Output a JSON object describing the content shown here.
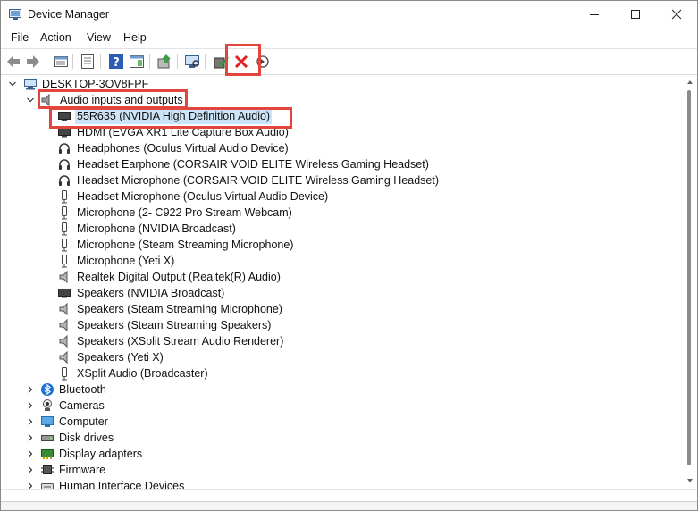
{
  "window": {
    "title": "Device Manager"
  },
  "menu": [
    "File",
    "Action",
    "View",
    "Help"
  ],
  "toolbar": [
    "back-icon",
    "forward-icon",
    "properties-grid-icon",
    "console-tree-icon",
    "help-icon",
    "action-pane-icon",
    "update-driver-icon",
    "scan-hardware-icon",
    "enable-device-icon",
    "uninstall-device-icon",
    "disable-device-icon"
  ],
  "tree": {
    "root": "DESKTOP-3OV8FPF",
    "expanded_category": "Audio inputs and outputs",
    "audio_devices": [
      {
        "label": "55R635 (NVIDIA High Definition Audio)",
        "icon": "monitor-icon"
      },
      {
        "label": "HDMI (EVGA XR1 Lite Capture Box Audio)",
        "icon": "monitor-icon"
      },
      {
        "label": "Headphones (Oculus Virtual Audio Device)",
        "icon": "headphones-icon"
      },
      {
        "label": "Headset Earphone (CORSAIR VOID ELITE Wireless Gaming Headset)",
        "icon": "headphones-icon"
      },
      {
        "label": "Headset Microphone (CORSAIR VOID ELITE Wireless Gaming Headset)",
        "icon": "headphones-icon"
      },
      {
        "label": "Headset Microphone (Oculus Virtual Audio Device)",
        "icon": "microphone-icon"
      },
      {
        "label": "Microphone (2- C922 Pro Stream Webcam)",
        "icon": "microphone-icon"
      },
      {
        "label": "Microphone (NVIDIA Broadcast)",
        "icon": "microphone-icon"
      },
      {
        "label": "Microphone (Steam Streaming Microphone)",
        "icon": "microphone-icon"
      },
      {
        "label": "Microphone (Yeti X)",
        "icon": "microphone-icon"
      },
      {
        "label": "Realtek Digital Output (Realtek(R) Audio)",
        "icon": "speaker-icon"
      },
      {
        "label": "Speakers (NVIDIA Broadcast)",
        "icon": "monitor-icon"
      },
      {
        "label": "Speakers (Steam Streaming Microphone)",
        "icon": "speaker-icon"
      },
      {
        "label": "Speakers (Steam Streaming Speakers)",
        "icon": "speaker-icon"
      },
      {
        "label": "Speakers (XSplit  Stream  Audio  Renderer)",
        "icon": "speaker-icon"
      },
      {
        "label": "Speakers (Yeti X)",
        "icon": "speaker-icon"
      },
      {
        "label": "XSplit Audio (Broadcaster)",
        "icon": "microphone-icon"
      }
    ],
    "categories": [
      {
        "label": "Bluetooth",
        "icon": "bluetooth-icon"
      },
      {
        "label": "Cameras",
        "icon": "camera-icon"
      },
      {
        "label": "Computer",
        "icon": "computer-icon"
      },
      {
        "label": "Disk drives",
        "icon": "disk-drive-icon"
      },
      {
        "label": "Display adapters",
        "icon": "display-adapter-icon"
      },
      {
        "label": "Firmware",
        "icon": "firmware-icon"
      },
      {
        "label": "Human Interface Devices",
        "icon": "hid-icon"
      }
    ]
  },
  "colors": {
    "highlight_red": "#e2453c",
    "selection": "#cce4f7"
  }
}
